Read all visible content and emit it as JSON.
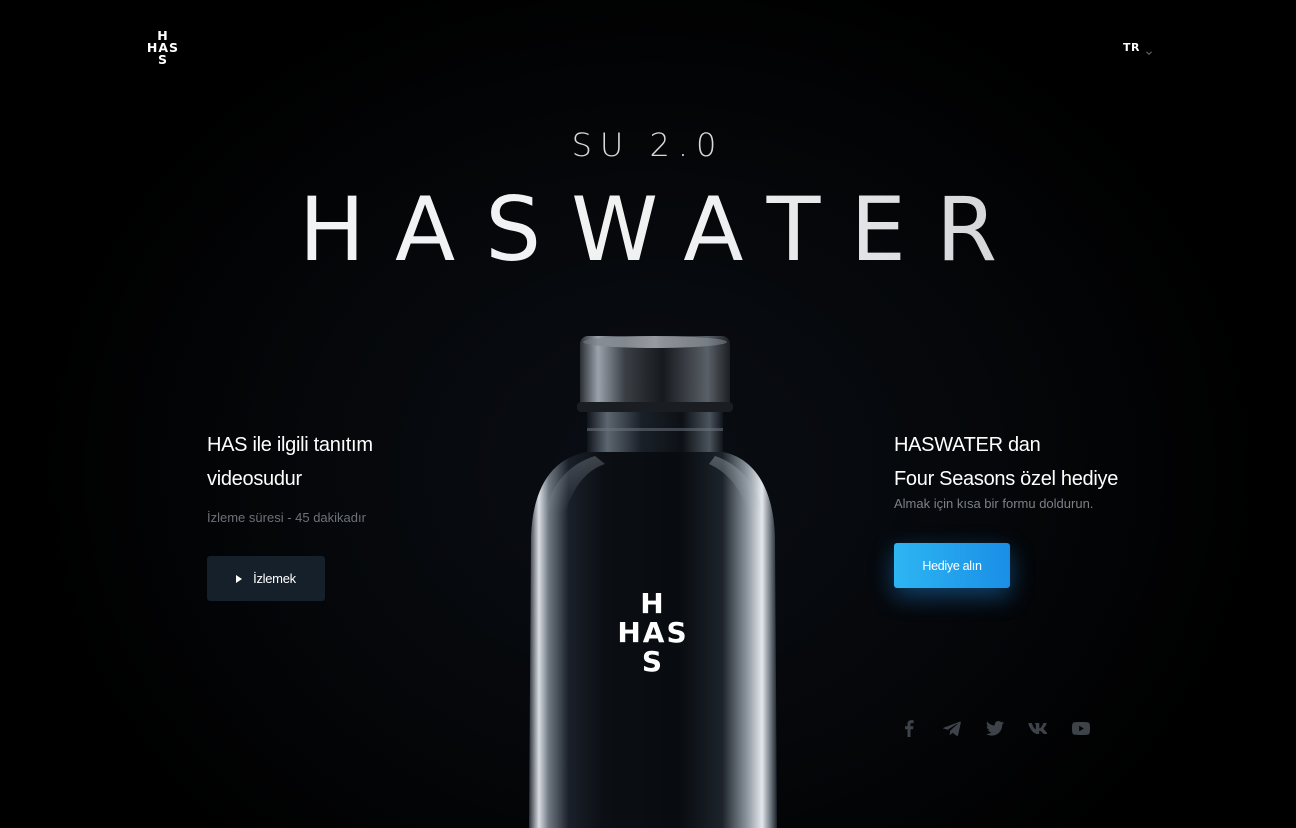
{
  "header": {
    "logo": {
      "line1": "H",
      "line2": "HAS",
      "line3": "S"
    },
    "language": {
      "code": "TR"
    }
  },
  "hero": {
    "subtitle": "SU 2.0",
    "title": "HASWATER"
  },
  "bottle": {
    "logo": {
      "line1": "H",
      "line2": "HAS",
      "line3": "S"
    }
  },
  "video_section": {
    "heading_line1": "HAS ile ilgili tanıtım",
    "heading_line2": "videosudur",
    "duration_text": "İzleme süresi - 45 dakikadır",
    "button_label": "İzlemek"
  },
  "gift_section": {
    "heading_line1": "HASWATER dan",
    "heading_line2": "Four Seasons özel hediye",
    "description": "Almak için kısa bir formu doldurun.",
    "button_label": "Hediye alın"
  },
  "social": {
    "icons": [
      "facebook-icon",
      "telegram-icon",
      "twitter-icon",
      "vk-icon",
      "youtube-icon"
    ]
  },
  "colors": {
    "background": "#000000",
    "accent_button": "#1a8ee6",
    "secondary_button": "#16202a",
    "muted_text": "#6c7279",
    "social_icon": "#3d4349"
  }
}
